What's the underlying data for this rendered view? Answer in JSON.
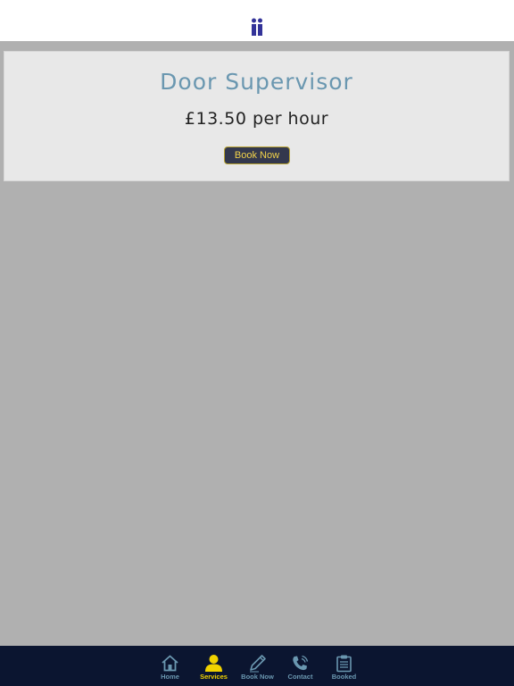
{
  "header": {
    "logo_icon": "people-logo-icon",
    "logo_color": "#333399"
  },
  "service": {
    "title": "Door Supervisor",
    "price": "£13.50 per hour",
    "book_label": "Book Now"
  },
  "tab_bar": {
    "active": "Services",
    "tabs": [
      {
        "label": "Home",
        "icon": "home-icon"
      },
      {
        "label": "Services",
        "icon": "person-icon"
      },
      {
        "label": "Book Now",
        "icon": "pencil-icon"
      },
      {
        "label": "Contact",
        "icon": "phone-icon"
      },
      {
        "label": "Booked",
        "icon": "clipboard-icon"
      }
    ]
  },
  "colors": {
    "accent": "#f1d200",
    "tab_inactive": "#6a97b0",
    "tab_bar_bg": "#0b1530",
    "title": "#6a97b0",
    "button_bg": "#33384d"
  }
}
